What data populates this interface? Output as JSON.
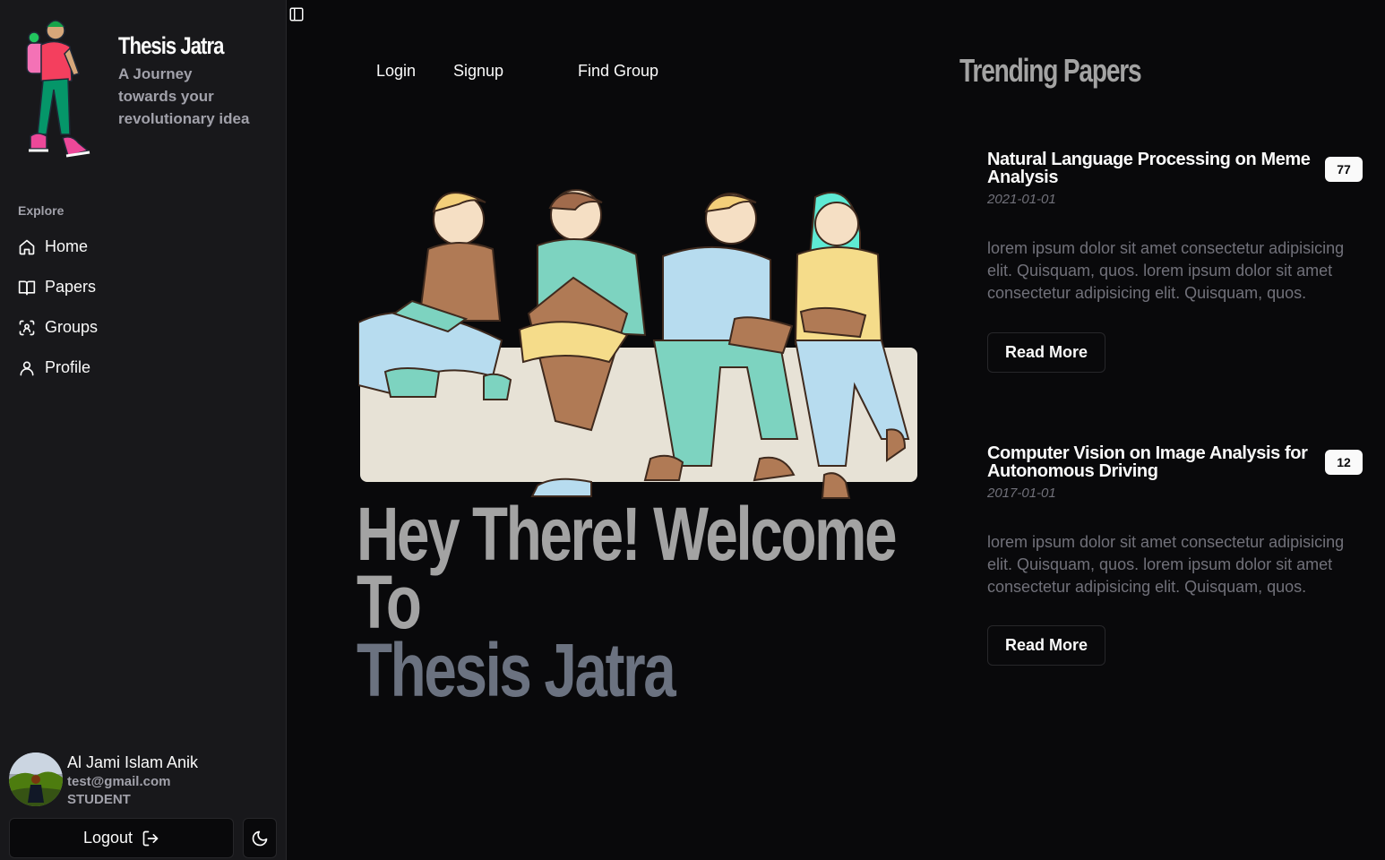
{
  "brand": {
    "title": "Thesis Jatra",
    "tagline": "A Journey towards your revolutionary idea"
  },
  "sidebar": {
    "section_label": "Explore",
    "items": [
      {
        "label": "Home",
        "icon": "home-icon"
      },
      {
        "label": "Papers",
        "icon": "book-open-icon"
      },
      {
        "label": "Groups",
        "icon": "scan-group-icon"
      },
      {
        "label": "Profile",
        "icon": "user-icon"
      }
    ]
  },
  "user": {
    "name": "Al Jami Islam Anik",
    "email": "test@gmail.com",
    "role": "STUDENT"
  },
  "footer": {
    "logout_label": "Logout",
    "logout_icon": "log-out-icon",
    "theme_icon": "moon-icon"
  },
  "topnav": {
    "login": "Login",
    "signup": "Signup",
    "find_group": "Find Group"
  },
  "hero": {
    "line1": "Hey There! Welcome To",
    "line2": "Thesis Jatra"
  },
  "trending": {
    "title": "Trending Papers",
    "papers": [
      {
        "title": "Natural Language Processing on Meme Analysis",
        "count": "77",
        "date": "2021-01-01",
        "description": "lorem ipsum dolor sit amet consectetur adipisicing elit. Quisquam, quos. lorem ipsum dolor sit amet consectetur adipisicing elit. Quisquam, quos.",
        "button": "Read More"
      },
      {
        "title": "Computer Vision on Image Analysis for Autonomous Driving",
        "count": "12",
        "date": "2017-01-01",
        "description": "lorem ipsum dolor sit amet consectetur adipisicing elit. Quisquam, quos. lorem ipsum dolor sit amet consectetur adipisicing elit. Quisquam, quos.",
        "button": "Read More"
      }
    ]
  },
  "colors": {
    "background": "#09090b",
    "sidebar": "#18181b",
    "border": "#27272a",
    "muted_text": "#a1a1aa",
    "hero_gray": "#a3a3a3",
    "hero_slate": "#6b7280"
  }
}
